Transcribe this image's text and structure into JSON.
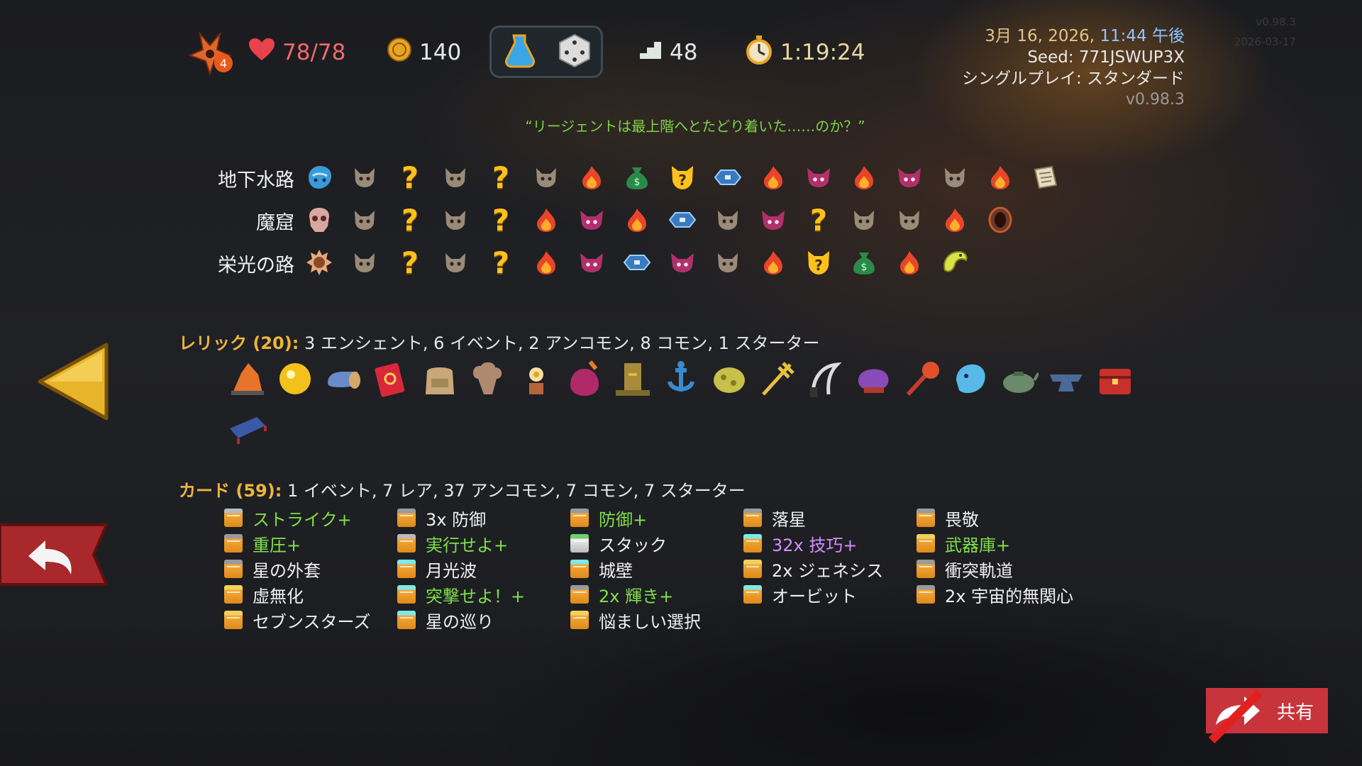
{
  "topbar": {
    "character_icon": "flame-crest-icon",
    "ascension_level": "4",
    "hp": "78/78",
    "gold": "140",
    "potions": [
      "potion-flask-icon",
      "dice-icon"
    ],
    "floor": "48",
    "playtime": "1:19:24"
  },
  "meta": {
    "date": "3月 16, 2026,",
    "time": "11:44 午後",
    "seed": "Seed: 771JSWUP3X",
    "mode": "シングルプレイ: スタンダード",
    "version": "v0.98.3"
  },
  "ghost_meta": {
    "version": "v0.98.3",
    "date": "2026-03-17"
  },
  "quote": "“リージェントは最上階へとたどり着いた……のか？”",
  "acts": [
    {
      "name": "地下水路",
      "boss": "sea-serpent-icon",
      "nodes": [
        "monster",
        "unknown",
        "monster",
        "unknown",
        "monster",
        "rest",
        "merchant",
        "event-monster",
        "treasure",
        "rest",
        "elite",
        "rest",
        "elite",
        "monster",
        "rest",
        "scroll-boss"
      ]
    },
    {
      "name": "魔窟",
      "boss": "skull-beast-icon",
      "nodes": [
        "monster",
        "unknown",
        "monster",
        "unknown",
        "rest",
        "elite",
        "rest",
        "treasure",
        "monster",
        "elite",
        "unknown",
        "monster",
        "monster",
        "rest",
        "portal-boss"
      ]
    },
    {
      "name": "栄光の路",
      "boss": "spiked-sun-icon",
      "nodes": [
        "monster",
        "unknown",
        "monster",
        "unknown",
        "rest",
        "elite",
        "treasure",
        "elite",
        "monster",
        "rest",
        "event-monster",
        "merchant",
        "rest",
        "serpent-boss"
      ]
    }
  ],
  "relics_section": {
    "label": "レリック (20):",
    "summary": "3 エンシェント, 6 イベント, 2 アンコモン, 8 コモン, 1 スターター",
    "items": [
      "ember-stone-icon",
      "golden-orb-icon",
      "scroll-jar-icon",
      "red-book-icon",
      "backpack-icon",
      "mushroom-icon",
      "flower-pot-icon",
      "potion-bottle-icon",
      "tree-stump-icon",
      "anchor-icon",
      "bean-icon",
      "trident-icon",
      "sickle-icon",
      "purple-pillow-icon",
      "mace-icon",
      "ghost-fish-icon",
      "teapot-icon",
      "anvil-icon",
      "red-chest-icon",
      "bench-icon"
    ]
  },
  "cards_section": {
    "label": "カード (59):",
    "summary": "1 イベント, 7 レア, 37 アンコモン, 7 コモン, 7 スターター",
    "columns": [
      [
        {
          "name": "ストライク+",
          "color": "green",
          "icon": "gold"
        },
        {
          "name": "重圧+",
          "color": "green",
          "icon": "grey"
        },
        {
          "name": "星の外套",
          "color": "white",
          "icon": "grey"
        },
        {
          "name": "虚無化",
          "color": "white",
          "icon": "yellow"
        },
        {
          "name": "セブンスターズ",
          "color": "white",
          "icon": "yellow"
        }
      ],
      [
        {
          "name": "3x 防御",
          "color": "white",
          "icon": "grey"
        },
        {
          "name": "実行せよ+",
          "color": "green",
          "icon": "gold"
        },
        {
          "name": "月光波",
          "color": "white",
          "icon": "teal"
        },
        {
          "name": "突撃せよ！+",
          "color": "green",
          "icon": "teal"
        },
        {
          "name": "星の巡り",
          "color": "white",
          "icon": "teal"
        }
      ],
      [
        {
          "name": "防御+",
          "color": "green",
          "icon": "grey"
        },
        {
          "name": "スタック",
          "color": "white",
          "icon": "green"
        },
        {
          "name": "城壁",
          "color": "white",
          "icon": "teal"
        },
        {
          "name": "2x 輝き+",
          "color": "green",
          "icon": "grey"
        },
        {
          "name": "悩ましい選択",
          "color": "white",
          "icon": "yellow"
        }
      ],
      [
        {
          "name": "落星",
          "color": "white",
          "icon": "grey"
        },
        {
          "name": "32x 技巧+",
          "color": "purple",
          "icon": "teal"
        },
        {
          "name": "2x ジェネシス",
          "color": "white",
          "icon": "yellow"
        },
        {
          "name": "オービット",
          "color": "white",
          "icon": "teal"
        }
      ],
      [
        {
          "name": "畏敬",
          "color": "white",
          "icon": "grey"
        },
        {
          "name": "武器庫+",
          "color": "green",
          "icon": "yellow"
        },
        {
          "name": "衝突軌道",
          "color": "white",
          "icon": "grey"
        },
        {
          "name": "2x 宇宙的無関心",
          "color": "white",
          "icon": "grey"
        }
      ]
    ]
  },
  "share_button": {
    "label": "共有",
    "icon": "share-arrow-icon"
  },
  "nav": {
    "prev_icon": "left-triangle-icon",
    "back_icon": "return-arrow-icon"
  }
}
